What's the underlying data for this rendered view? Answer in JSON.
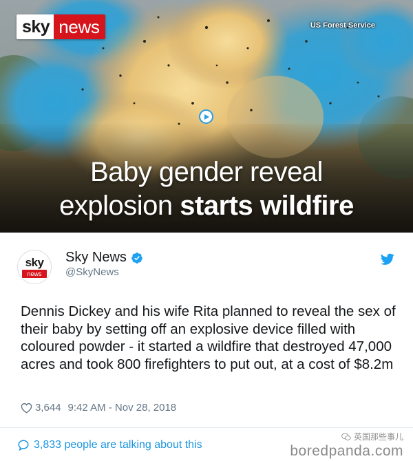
{
  "video": {
    "logo": {
      "sky": "sky",
      "news": "news"
    },
    "credit": "US Forest Service",
    "headline": {
      "line1": "Baby gender reveal",
      "line2_regular": "explosion ",
      "line2_bold": "starts wildfire"
    },
    "play_icon": "play-icon"
  },
  "tweet": {
    "avatar": {
      "sky": "sky",
      "news": "news"
    },
    "display_name": "Sky News",
    "handle": "@SkyNews",
    "verified_icon": "verified-badge-icon",
    "platform_icon": "twitter-bird-icon",
    "text": "Dennis Dickey and his wife Rita planned to reveal the sex of their baby by setting off an explosive device filled with coloured powder - it started a wildfire that destroyed 47,000 acres and took 800 firefighters to put out, at a cost of $8.2m",
    "likes": "3,644",
    "timestamp": "9:42 AM - Nov 28, 2018",
    "talking": "3,833 people are talking about this"
  },
  "watermark": {
    "top": "英国那些事儿",
    "bottom": "boredpanda.com"
  },
  "colors": {
    "sky_red": "#d6141c",
    "twitter_blue": "#1da1f2",
    "link_blue": "#1b95e0",
    "muted_gray": "#657786"
  }
}
